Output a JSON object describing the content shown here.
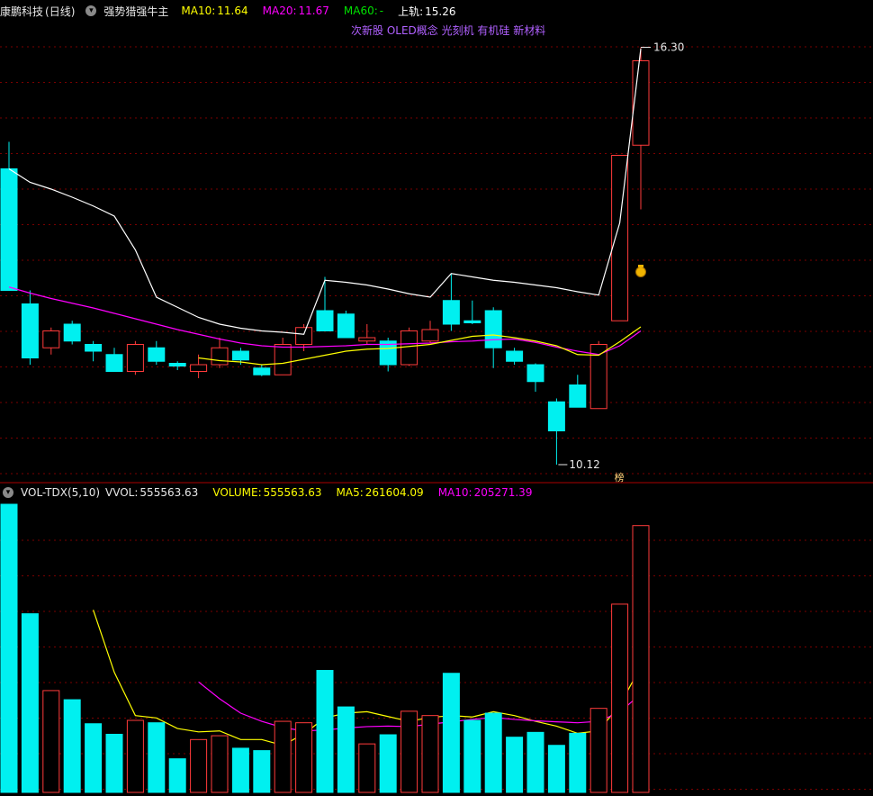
{
  "header": {
    "stock_name": "康鹏科技",
    "period": "(日线)",
    "formula": "强势猎强牛主",
    "ma10_label": "MA10:",
    "ma10_value": "11.64",
    "ma20_label": "MA20:",
    "ma20_value": "11.67",
    "ma60_label": "MA60:",
    "ma60_value": "-",
    "upper_label": "上轨:",
    "upper_value": "15.26"
  },
  "concepts": "次新股 OLED概念 光刻机 有机硅 新材料",
  "price_annotations": {
    "high": "16.30",
    "low": "10.12",
    "list_tag": "榜",
    "money_icon": "money-bag-icon"
  },
  "volume_header": {
    "indicator": "VOL-TDX(5,10)",
    "vvol_label": "VVOL:",
    "vvol_value": "555563.63",
    "volume_label": "VOLUME:",
    "volume_value": "555563.63",
    "ma5_label": "MA5:",
    "ma5_value": "261604.09",
    "ma10_label": "MA10:",
    "ma10_value": "205271.39"
  },
  "colors": {
    "up": "#ff3b3b",
    "down": "#00f0f0",
    "ma10": "#ffff00",
    "ma20": "#ff00ff",
    "ma60": "#00e000",
    "upper": "#ffffff",
    "grid": "#7a0000",
    "concept": "#b060ff"
  },
  "chart_data": {
    "type": "candlestick",
    "candles": [
      {
        "o": 14.5,
        "c": 12.7,
        "h": 14.9,
        "l": 12.7,
        "v": 600000
      },
      {
        "o": 12.5,
        "c": 11.7,
        "h": 12.7,
        "l": 11.6,
        "v": 372000
      },
      {
        "o": 11.85,
        "c": 12.1,
        "h": 12.15,
        "l": 11.75,
        "v": 212000
      },
      {
        "o": 12.2,
        "c": 11.95,
        "h": 12.25,
        "l": 11.9,
        "v": 193000
      },
      {
        "o": 11.9,
        "c": 11.8,
        "h": 11.95,
        "l": 11.65,
        "v": 143000
      },
      {
        "o": 11.75,
        "c": 11.5,
        "h": 11.85,
        "l": 11.5,
        "v": 121000
      },
      {
        "o": 11.5,
        "c": 11.9,
        "h": 11.95,
        "l": 11.45,
        "v": 150000
      },
      {
        "o": 11.85,
        "c": 11.65,
        "h": 11.95,
        "l": 11.6,
        "v": 145000
      },
      {
        "o": 11.62,
        "c": 11.58,
        "h": 11.65,
        "l": 11.52,
        "v": 70000
      },
      {
        "o": 11.5,
        "c": 11.6,
        "h": 11.75,
        "l": 11.4,
        "v": 110000
      },
      {
        "o": 11.6,
        "c": 11.85,
        "h": 12.0,
        "l": 11.55,
        "v": 118000
      },
      {
        "o": 11.8,
        "c": 11.67,
        "h": 11.85,
        "l": 11.6,
        "v": 92000
      },
      {
        "o": 11.55,
        "c": 11.45,
        "h": 11.6,
        "l": 11.43,
        "v": 87000
      },
      {
        "o": 11.45,
        "c": 11.9,
        "h": 12.0,
        "l": 11.45,
        "v": 148000
      },
      {
        "o": 11.9,
        "c": 12.15,
        "h": 12.2,
        "l": 11.8,
        "v": 145000
      },
      {
        "o": 12.4,
        "c": 12.1,
        "h": 12.9,
        "l": 12.1,
        "v": 254000
      },
      {
        "o": 12.35,
        "c": 12.0,
        "h": 12.4,
        "l": 12.0,
        "v": 178000
      },
      {
        "o": 11.95,
        "c": 12.0,
        "h": 12.2,
        "l": 11.9,
        "v": 101000
      },
      {
        "o": 11.95,
        "c": 11.6,
        "h": 12.0,
        "l": 11.5,
        "v": 120000
      },
      {
        "o": 11.6,
        "c": 12.1,
        "h": 12.15,
        "l": 11.58,
        "v": 169000
      },
      {
        "o": 11.95,
        "c": 12.12,
        "h": 12.25,
        "l": 11.92,
        "v": 160000
      },
      {
        "o": 12.55,
        "c": 12.2,
        "h": 12.95,
        "l": 12.1,
        "v": 248000
      },
      {
        "o": 12.25,
        "c": 12.22,
        "h": 12.55,
        "l": 12.2,
        "v": 150000
      },
      {
        "o": 12.4,
        "c": 11.85,
        "h": 12.45,
        "l": 11.55,
        "v": 165000
      },
      {
        "o": 11.8,
        "c": 11.65,
        "h": 11.85,
        "l": 11.6,
        "v": 115000
      },
      {
        "o": 11.6,
        "c": 11.35,
        "h": 11.62,
        "l": 11.2,
        "v": 125000
      },
      {
        "o": 11.05,
        "c": 10.62,
        "h": 11.1,
        "l": 10.12,
        "v": 98000
      },
      {
        "o": 11.3,
        "c": 10.97,
        "h": 11.45,
        "l": 10.97,
        "v": 123000
      },
      {
        "o": 10.95,
        "c": 11.9,
        "h": 11.95,
        "l": 10.95,
        "v": 175000
      },
      {
        "o": 12.25,
        "c": 14.7,
        "h": 14.7,
        "l": 12.25,
        "v": 392000
      },
      {
        "o": 14.85,
        "c": 16.1,
        "h": 16.3,
        "l": 13.9,
        "v": 555563
      }
    ],
    "ma10": [
      null,
      null,
      null,
      null,
      null,
      null,
      null,
      null,
      null,
      11.7,
      11.66,
      11.64,
      11.6,
      11.62,
      11.68,
      11.74,
      11.8,
      11.83,
      11.84,
      11.87,
      11.9,
      11.96,
      12.02,
      12.04,
      12.0,
      11.95,
      11.88,
      11.75,
      11.74,
      11.94,
      12.16
    ],
    "ma20": [
      12.75,
      12.66,
      12.58,
      12.51,
      12.44,
      12.36,
      12.28,
      12.2,
      12.12,
      12.05,
      11.98,
      11.92,
      11.88,
      11.86,
      11.86,
      11.87,
      11.88,
      11.9,
      11.9,
      11.91,
      11.92,
      11.94,
      11.95,
      11.97,
      11.98,
      11.93,
      11.86,
      11.8,
      11.75,
      11.88,
      12.1
    ],
    "upper": [
      14.5,
      14.3,
      14.2,
      14.08,
      13.95,
      13.8,
      13.3,
      12.6,
      12.45,
      12.3,
      12.2,
      12.14,
      12.1,
      12.08,
      12.05,
      12.85,
      12.82,
      12.78,
      12.72,
      12.65,
      12.6,
      12.95,
      12.9,
      12.85,
      12.82,
      12.78,
      12.74,
      12.68,
      12.63,
      13.7,
      16.28
    ],
    "vol_ma5": [
      null,
      null,
      null,
      null,
      380000,
      250000,
      160000,
      155000,
      133000,
      126000,
      128000,
      110000,
      110000,
      98000,
      122000,
      155000,
      165000,
      168000,
      158000,
      148000,
      156000,
      160000,
      157000,
      168000,
      160000,
      148000,
      138000,
      123000,
      128000,
      182000,
      261604
    ],
    "vol_ma10": [
      null,
      null,
      null,
      null,
      null,
      null,
      null,
      null,
      null,
      230000,
      195000,
      165000,
      148000,
      135000,
      128000,
      130000,
      134000,
      137000,
      138000,
      137000,
      142000,
      147000,
      152000,
      156000,
      152000,
      149000,
      147000,
      145000,
      148000,
      167000,
      205271
    ],
    "ylim": [
      10.0,
      16.6
    ]
  }
}
